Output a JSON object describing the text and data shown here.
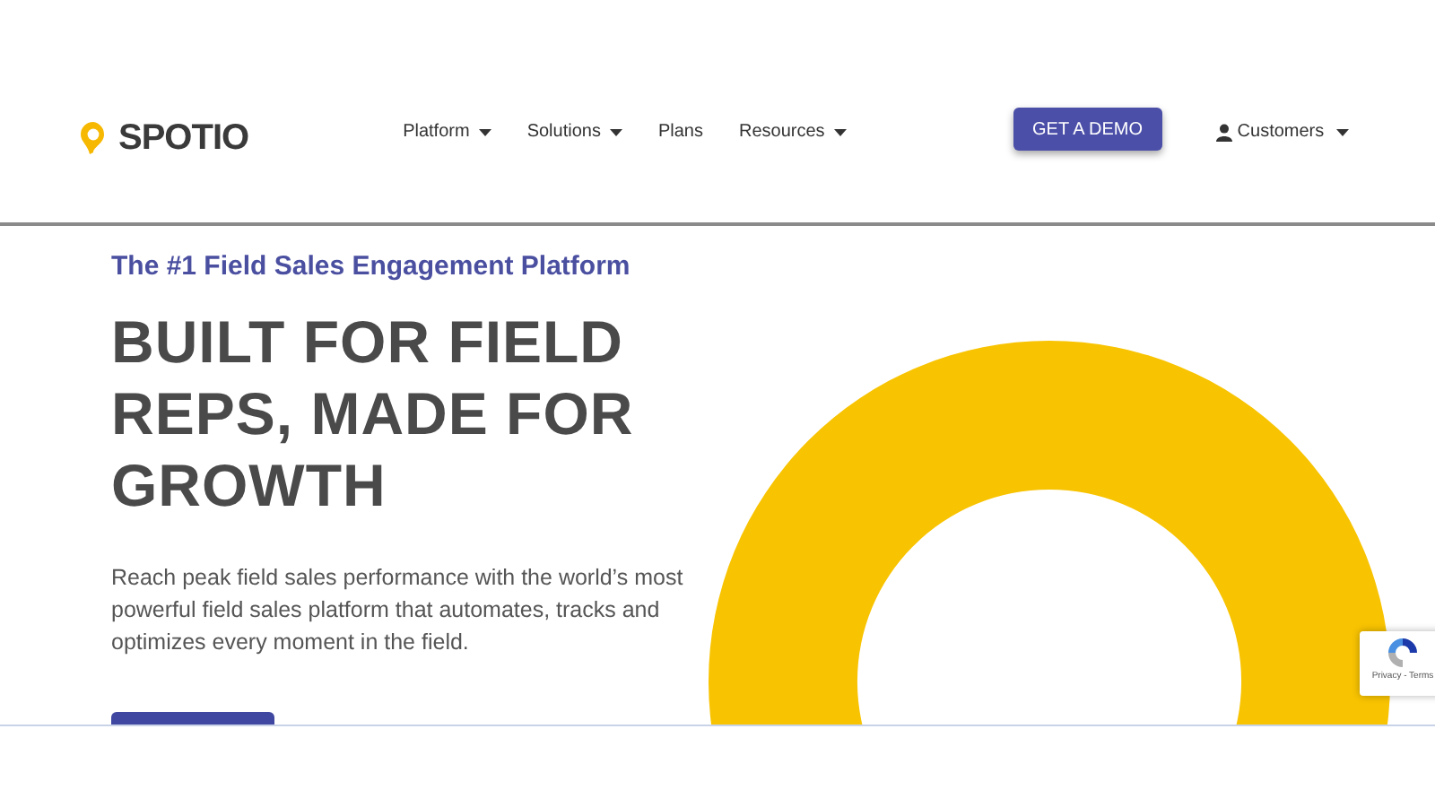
{
  "header": {
    "logo": "SPOTIO",
    "nav": [
      {
        "label": "Platform",
        "dropdown": true
      },
      {
        "label": "Solutions",
        "dropdown": true
      },
      {
        "label": "Plans",
        "dropdown": false
      },
      {
        "label": "Resources",
        "dropdown": true
      }
    ],
    "demo_button": "GET A DEMO",
    "account_menu": {
      "label": "Customers",
      "dropdown": true
    }
  },
  "hero": {
    "tagline": "The #1 Field Sales Engagement Platform",
    "headline": [
      "BUILT FOR FIELD",
      "REPS, MADE FOR",
      "GROWTH"
    ],
    "description": "Reach peak field sales performance with the world’s most powerful field sales platform that automates, tracks and optimizes every moment in the field."
  },
  "recaptcha": {
    "text": "Privacy - Terms"
  }
}
